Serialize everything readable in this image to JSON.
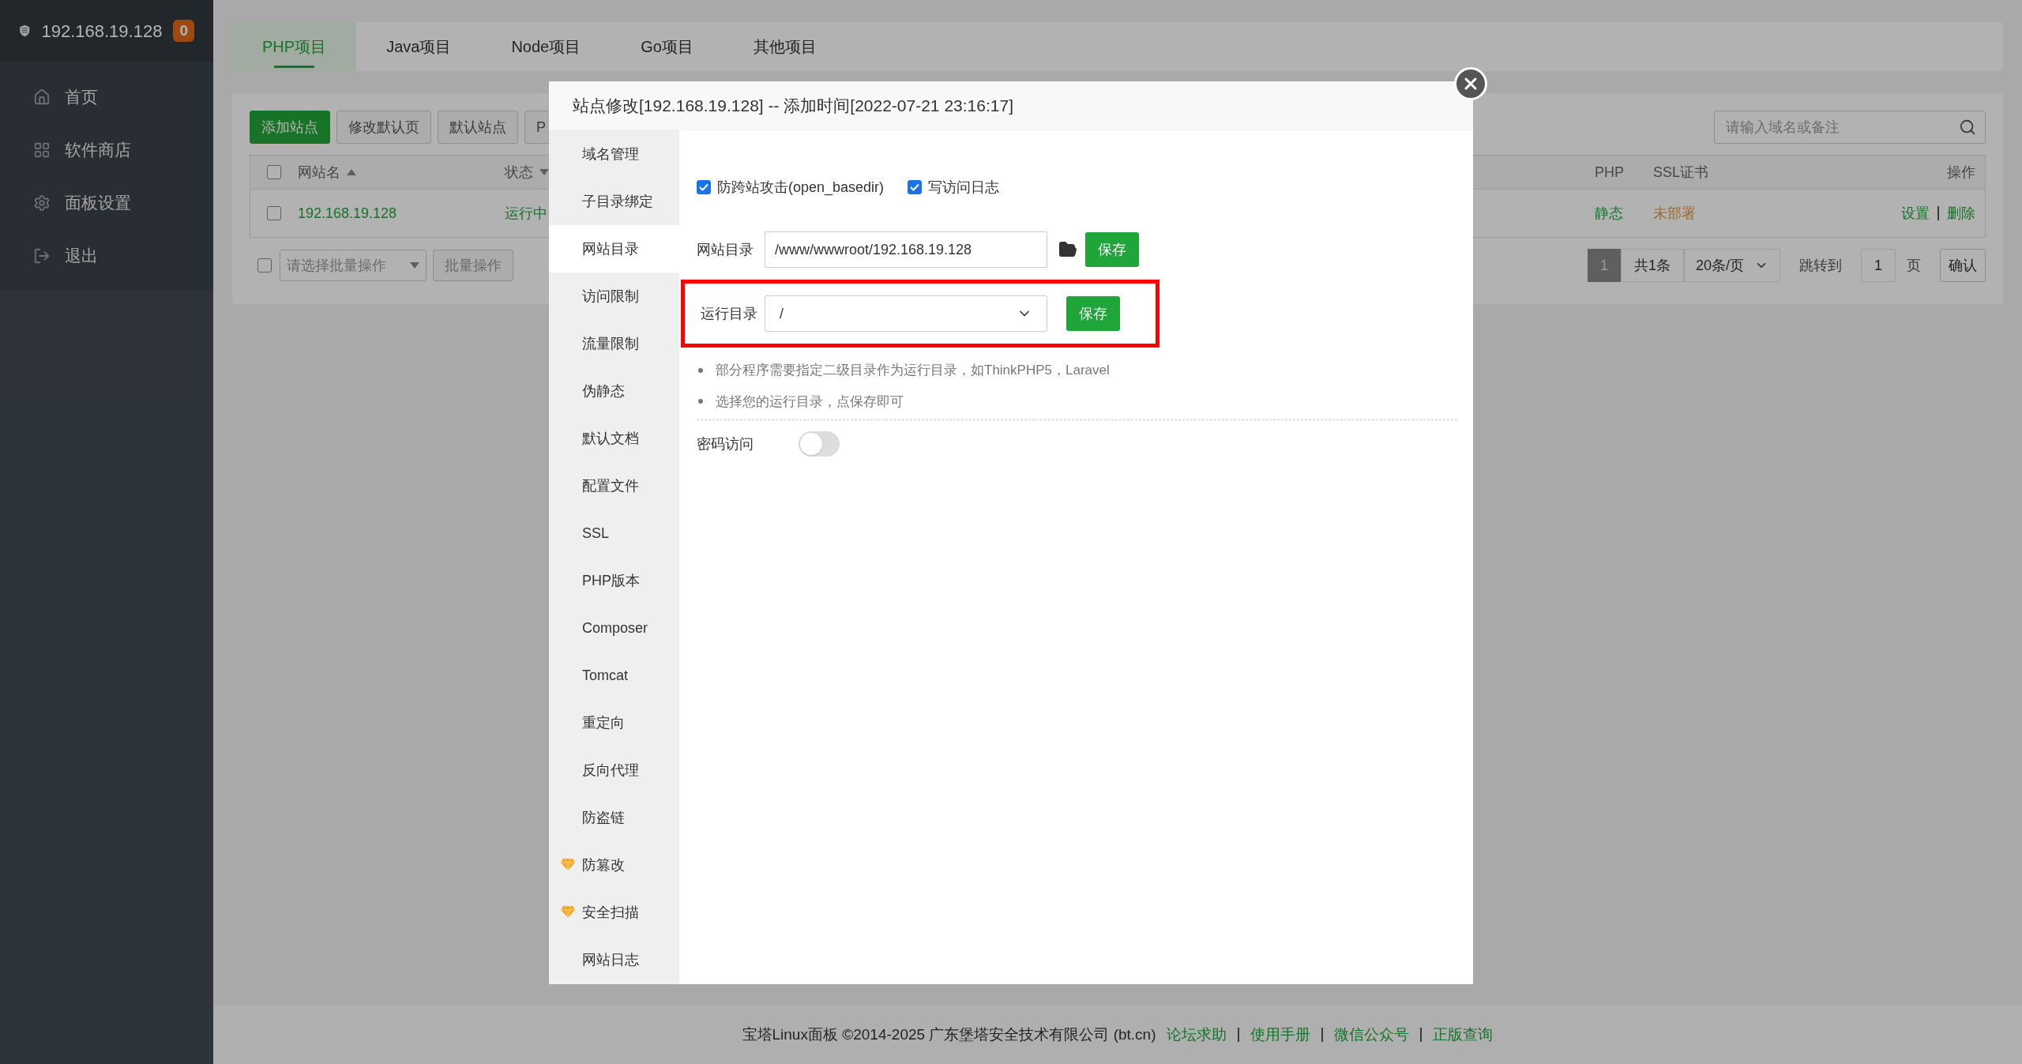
{
  "sidebar": {
    "title": "192.168.19.128",
    "badge": "0",
    "items": [
      {
        "label": "首页"
      },
      {
        "label": "软件商店"
      },
      {
        "label": "面板设置"
      },
      {
        "label": "退出"
      }
    ]
  },
  "tabs": [
    {
      "label": "PHP项目",
      "selected": true
    },
    {
      "label": "Java项目",
      "selected": false
    },
    {
      "label": "Node项目",
      "selected": false
    },
    {
      "label": "Go项目",
      "selected": false
    },
    {
      "label": "其他项目",
      "selected": false
    }
  ],
  "toolbar": {
    "buttons": [
      {
        "label": "添加站点",
        "primary": true
      },
      {
        "label": "修改默认页",
        "primary": false
      },
      {
        "label": "默认站点",
        "primary": false
      },
      {
        "label": "P",
        "primary": false
      }
    ],
    "search": {
      "placeholder": "请输入域名或备注"
    }
  },
  "table": {
    "select_all_checked": false,
    "columns": [
      "网站名",
      "状态",
      "PHP",
      "SSL证书",
      "操作"
    ],
    "rows": [
      {
        "checked": false,
        "name": "192.168.19.128",
        "status": "运行中",
        "php": "静态",
        "ssl": "未部署",
        "actions": [
          "设置",
          "删除"
        ]
      }
    ]
  },
  "batch": {
    "checked": false,
    "select": "请选择批量操作",
    "button": "批量操作"
  },
  "pagination": {
    "current": "1",
    "total": "共1条",
    "per_page": "20条/页",
    "jump_label": "跳转到",
    "jump_value": "1",
    "page_unit": "页",
    "confirm": "确认"
  },
  "modal": {
    "title": "站点修改[192.168.19.128] -- 添加时间[2022-07-21 23:16:17]",
    "menu": [
      {
        "label": "域名管理",
        "selected": false,
        "premium": false
      },
      {
        "label": "子目录绑定",
        "selected": false,
        "premium": false
      },
      {
        "label": "网站目录",
        "selected": true,
        "premium": false
      },
      {
        "label": "访问限制",
        "selected": false,
        "premium": false
      },
      {
        "label": "流量限制",
        "selected": false,
        "premium": false
      },
      {
        "label": "伪静态",
        "selected": false,
        "premium": false
      },
      {
        "label": "默认文档",
        "selected": false,
        "premium": false
      },
      {
        "label": "配置文件",
        "selected": false,
        "premium": false
      },
      {
        "label": "SSL",
        "selected": false,
        "premium": false
      },
      {
        "label": "PHP版本",
        "selected": false,
        "premium": false
      },
      {
        "label": "Composer",
        "selected": false,
        "premium": false
      },
      {
        "label": "Tomcat",
        "selected": false,
        "premium": false
      },
      {
        "label": "重定向",
        "selected": false,
        "premium": false
      },
      {
        "label": "反向代理",
        "selected": false,
        "premium": false
      },
      {
        "label": "防盗链",
        "selected": false,
        "premium": false
      },
      {
        "label": "防篡改",
        "selected": false,
        "premium": true
      },
      {
        "label": "安全扫描",
        "selected": false,
        "premium": true
      },
      {
        "label": "网站日志",
        "selected": false,
        "premium": false
      }
    ],
    "checkboxes": [
      {
        "label": "防跨站攻击(open_basedir)",
        "checked": true
      },
      {
        "label": "写访问日志",
        "checked": true
      }
    ],
    "site_dir": {
      "label": "网站目录",
      "value": "/www/wwwroot/192.168.19.128",
      "button": "保存"
    },
    "run_dir": {
      "label": "运行目录",
      "value": "/",
      "button": "保存",
      "highlighted": true
    },
    "notes": [
      "部分程序需要指定二级目录作为运行目录，如ThinkPHP5，Laravel",
      "选择您的运行目录，点保存即可"
    ],
    "password_access": {
      "label": "密码访问",
      "on": false
    }
  },
  "footer": {
    "text": "宝塔Linux面板 ©2014-2025 广东堡塔安全技术有限公司 (bt.cn)",
    "links": [
      "论坛求助",
      "使用手册",
      "微信公众号",
      "正版查询"
    ]
  }
}
